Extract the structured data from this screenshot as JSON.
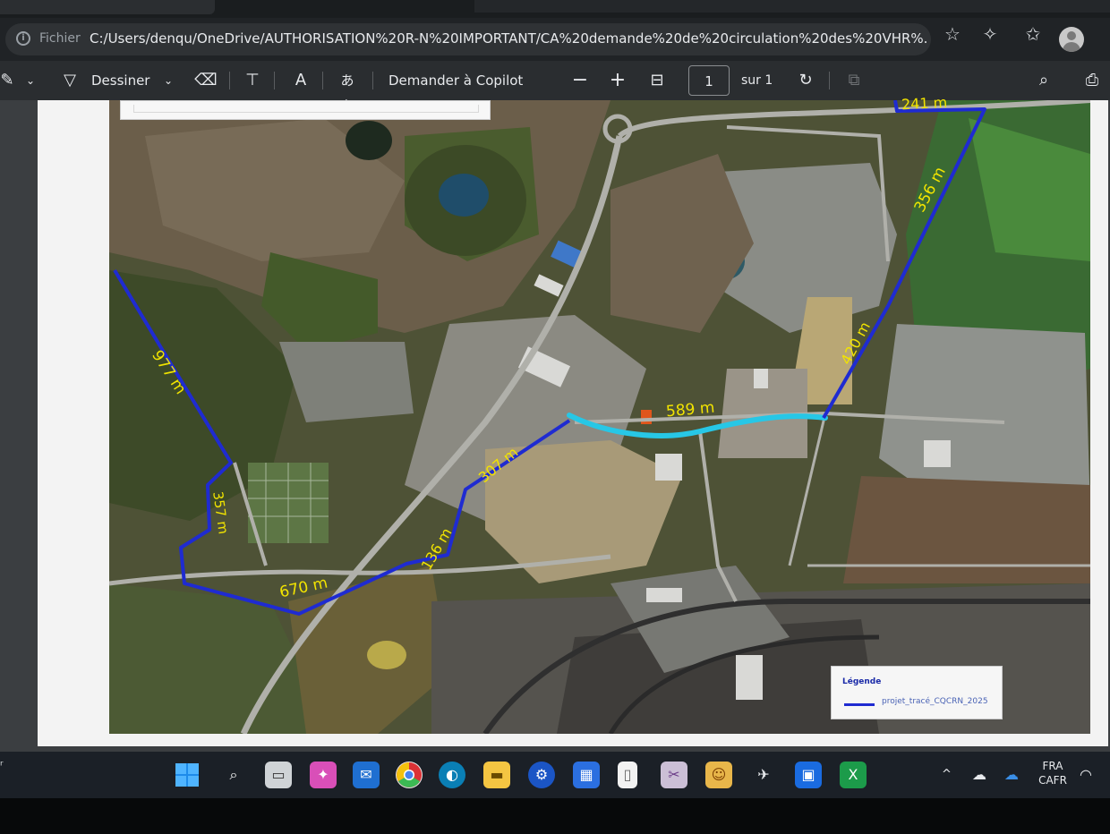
{
  "address_bar": {
    "prefix": "Fichier",
    "url": "C:/Users/denqu/OneDrive/AUTHORISATION%20R-N%20IMPORTANT/CA%20demande%20de%20circulation%20des%20VHR%..."
  },
  "pdf_toolbar": {
    "draw_label": "Dessiner",
    "copilot_label": "Demander à Copilot",
    "page_input": "1",
    "page_of": "sur 1",
    "zoom_out": "−",
    "zoom_in": "+"
  },
  "map": {
    "segments": [
      {
        "label": "977 m",
        "color": "#1f2bd1"
      },
      {
        "label": "357 m",
        "color": "#1f2bd1"
      },
      {
        "label": "670 m",
        "color": "#1f2bd1"
      },
      {
        "label": "136 m",
        "color": "#1f2bd1"
      },
      {
        "label": "307 m",
        "color": "#1f2bd1"
      },
      {
        "label": "589 m",
        "color": "#27c7e6"
      },
      {
        "label": "420 m",
        "color": "#1f2bd1"
      },
      {
        "label": "356 m",
        "color": "#1f2bd1"
      },
      {
        "label": "241 m",
        "color": "#1f2bd1"
      }
    ],
    "label_color": "#f2e400"
  },
  "legend": {
    "title": "Légende",
    "item": "projet_tracé_CQCRN_2025"
  },
  "taskbar": {
    "apps": [
      "windows-start",
      "search",
      "file-explorer-stack",
      "copilot",
      "mail",
      "chrome",
      "edge",
      "file-explorer",
      "settings-gear",
      "calendar",
      "blank-document",
      "snipping",
      "map-app",
      "satellite",
      "taskmgr",
      "excel"
    ],
    "language_line1": "FRA",
    "language_line2": "CAFR"
  }
}
